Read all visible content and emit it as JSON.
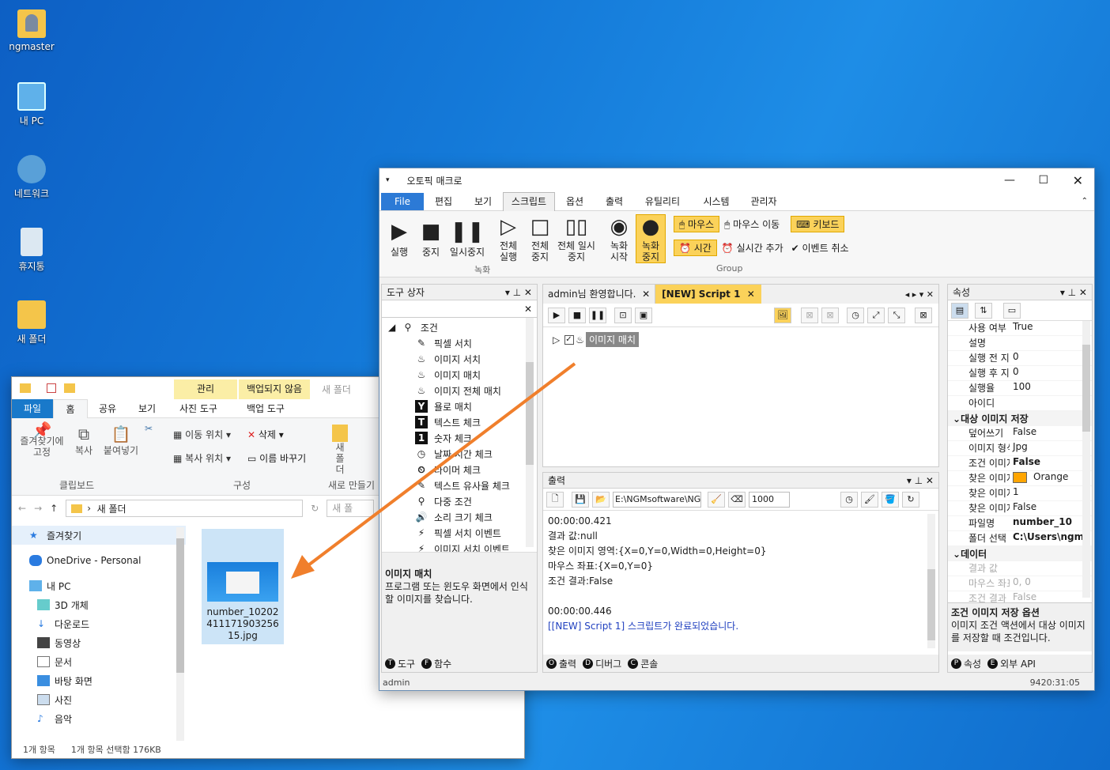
{
  "desktop": {
    "icons": [
      "ngmaster",
      "내 PC",
      "네트워크",
      "휴지통",
      "새 폴더"
    ]
  },
  "explorer": {
    "ctx_tab1": "관리",
    "ctx_tab2": "백업되지 않음",
    "title": "새 폴더",
    "tabs": [
      "파일",
      "홈",
      "공유",
      "보기",
      "사진 도구",
      "백업 도구"
    ],
    "ribbon": {
      "pin": "즐겨찾기에 고정",
      "copy": "복사",
      "paste": "붙여넣기",
      "clipboard": "클립보드",
      "move": "이동 위치",
      "copyto": "복사 위치",
      "delete": "삭제",
      "rename": "이름 바꾸기",
      "organize": "구성",
      "newfolder": "새 폴더",
      "newgroup": "새로 만들기"
    },
    "address": "새 폴더",
    "search_ph": "새 폴",
    "side": [
      "즐겨찾기",
      "OneDrive - Personal",
      "내 PC",
      "3D 개체",
      "다운로드",
      "동영상",
      "문서",
      "바탕 화면",
      "사진",
      "음악"
    ],
    "file": {
      "name": "number_1020241117190325615.jpg"
    },
    "status_count": "1개 항목",
    "status_sel": "1개 항목 선택함 176KB"
  },
  "macro": {
    "title": "오토픽 매크로",
    "menu": [
      "File",
      "편집",
      "보기",
      "스크립트",
      "옵션",
      "출력",
      "유틸리티",
      "시스템",
      "관리자"
    ],
    "tb": {
      "run": "실행",
      "stop": "중지",
      "pause": "일시중지",
      "all_run": "전체 실행",
      "all_stop": "전체 중지",
      "all_pause": "전체 일시중지",
      "rec_start": "녹화 시작",
      "rec_stop": "녹화 중지",
      "group1": "녹화",
      "mouse": "마우스",
      "mouse_move": "마우스 이동",
      "keyboard": "키보드",
      "time": "시간",
      "realtime": "실시간 추가",
      "cancel_event": "이벤트 취소",
      "group2": "Group"
    },
    "toolbox": {
      "title": "도구 상자",
      "root": "조건",
      "items": [
        "픽셀 서치",
        "이미지 서치",
        "이미지 매치",
        "이미지 전체 매치",
        "욜로 매치",
        "텍스트 체크",
        "숫자 체크",
        "날짜 시간 체크",
        "타이머 체크",
        "텍스트 유사율 체크",
        "다중 조건",
        "소리 크기 체크",
        "픽셀 서치 이벤트",
        "이미지 서치 이벤트"
      ],
      "desc_title": "이미지 매치",
      "desc": "프로그램 또는 윈도우 화면에서 인식할 이미지를 찾습니다."
    },
    "tabs": {
      "welcome": "admin님 환영합니다.",
      "script": "[NEW] Script 1"
    },
    "script_node": "이미지 매치",
    "output": {
      "title": "출력",
      "path": "E:\\NGMsoftware\\NG",
      "count": "1000",
      "lines": [
        "00:00:00.421",
        "결과 값:null",
        "찾은 이미지 영역:{X=0,Y=0,Width=0,Height=0}",
        "마우스 좌표:{X=0,Y=0}",
        "조건 결과:False",
        "",
        "00:00:00.446",
        "[[NEW] Script 1] 스크립트가 완료되었습니다."
      ]
    },
    "props": {
      "title": "속성",
      "rows": [
        {
          "k": "사용 여부",
          "v": "True"
        },
        {
          "k": "설명",
          "v": ""
        },
        {
          "k": "실행 전 지연",
          "v": "0"
        },
        {
          "k": "실행 후 지연",
          "v": "0"
        },
        {
          "k": "실행율",
          "v": "100"
        },
        {
          "k": "아이디",
          "v": ""
        }
      ],
      "cat1": "대상 이미지 저장",
      "rows2": [
        {
          "k": "덮어쓰기",
          "v": "False"
        },
        {
          "k": "이미지 형식",
          "v": "Jpg"
        },
        {
          "k": "조건 이미지",
          "v": "False"
        },
        {
          "k": "찾은 이미지",
          "v": "Orange"
        },
        {
          "k": "찾은 이미지",
          "v": "1"
        },
        {
          "k": "찾은 이미지",
          "v": "False"
        },
        {
          "k": "파일명",
          "v": "number_10"
        },
        {
          "k": "폴더 선택",
          "v": "C:\\Users\\ngm"
        }
      ],
      "cat2": "데이터",
      "rows3": [
        {
          "k": "결과 값",
          "v": ""
        },
        {
          "k": "마우스 좌표",
          "v": "0, 0"
        },
        {
          "k": "조건 결과",
          "v": "False"
        }
      ],
      "desc_title": "조건 이미지 저장 옵션",
      "desc": "이미지 조건 액션에서 대상 이미지를 저장할 때 조건입니다."
    },
    "bottom_tabs": {
      "tool": "도구",
      "func": "함수",
      "out": "출력",
      "debug": "디버그",
      "console": "콘솔",
      "prop": "속성",
      "api": "외부 API"
    },
    "status_user": "admin",
    "status_time": "9420:31:05"
  }
}
